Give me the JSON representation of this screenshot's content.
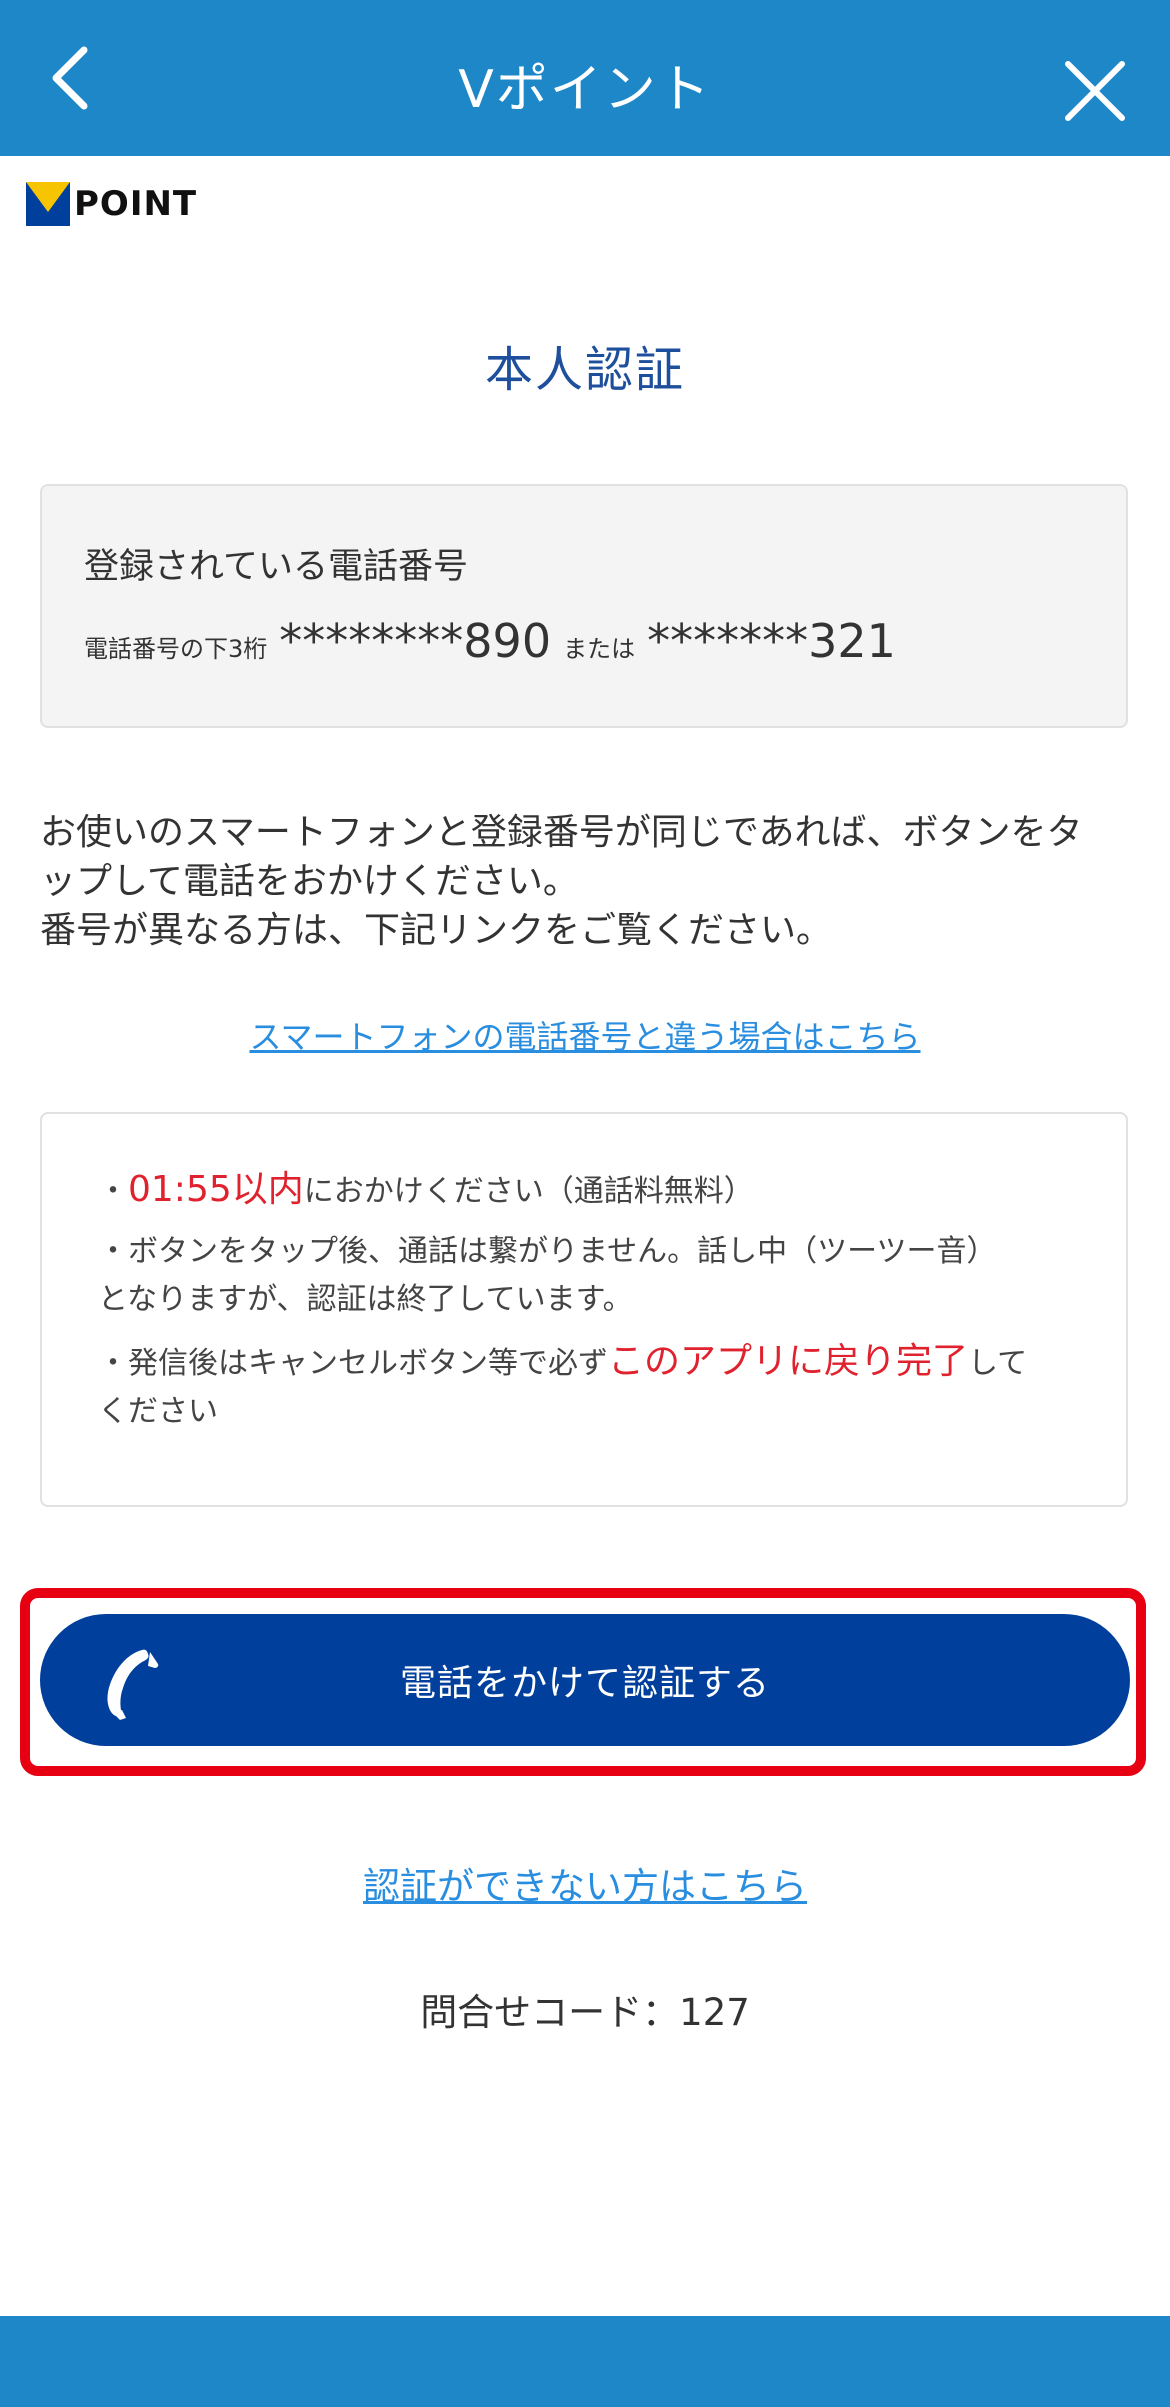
{
  "header": {
    "title": "Vポイント",
    "back_icon": "chevron-left-icon",
    "close_icon": "close-icon"
  },
  "logo": {
    "text": "POINT",
    "mark_icon": "v-logo-icon"
  },
  "page_title": "本人認証",
  "phone_info": {
    "label": "登録されている電話番号",
    "hint": "電話番号の下3桁",
    "number1": "********890",
    "or": "または",
    "number2": "*******321"
  },
  "description": {
    "line1": "お使いのスマートフォンと登録番号が同じであれば、ボタンをタ",
    "line2": "ップして電話をおかけください。",
    "line3": "番号が異なる方は、下記リンクをご覧ください。"
  },
  "different_number_link": "スマートフォンの電話番号と違う場合はこちら",
  "notice": {
    "item1_prefix": "・",
    "item1_highlight": "01:55以内",
    "item1_suffix": "におかけください（通話料無料）",
    "item2_line1": "・ボタンをタップ後、通話は繋がりません。話し中（ツーツー音）",
    "item2_line2": "となりますが、認証は終了しています。",
    "item3_prefix": "・発信後はキャンセルボタン等で必ず",
    "item3_highlight": "このアプリに戻り完了",
    "item3_suffix": "して",
    "item3_line2": "ください"
  },
  "call_button": {
    "label": "電話をかけて認証する",
    "icon": "phone-icon"
  },
  "cannot_auth_link": "認証ができない方はこちら",
  "inquiry_code": "問合せコード：127",
  "colors": {
    "header": "#1e87c8",
    "title_blue": "#1e4f9c",
    "button": "#003f9c",
    "highlight_frame": "#e60012",
    "link": "#2a8ee0",
    "alert_red": "#e0222e"
  }
}
